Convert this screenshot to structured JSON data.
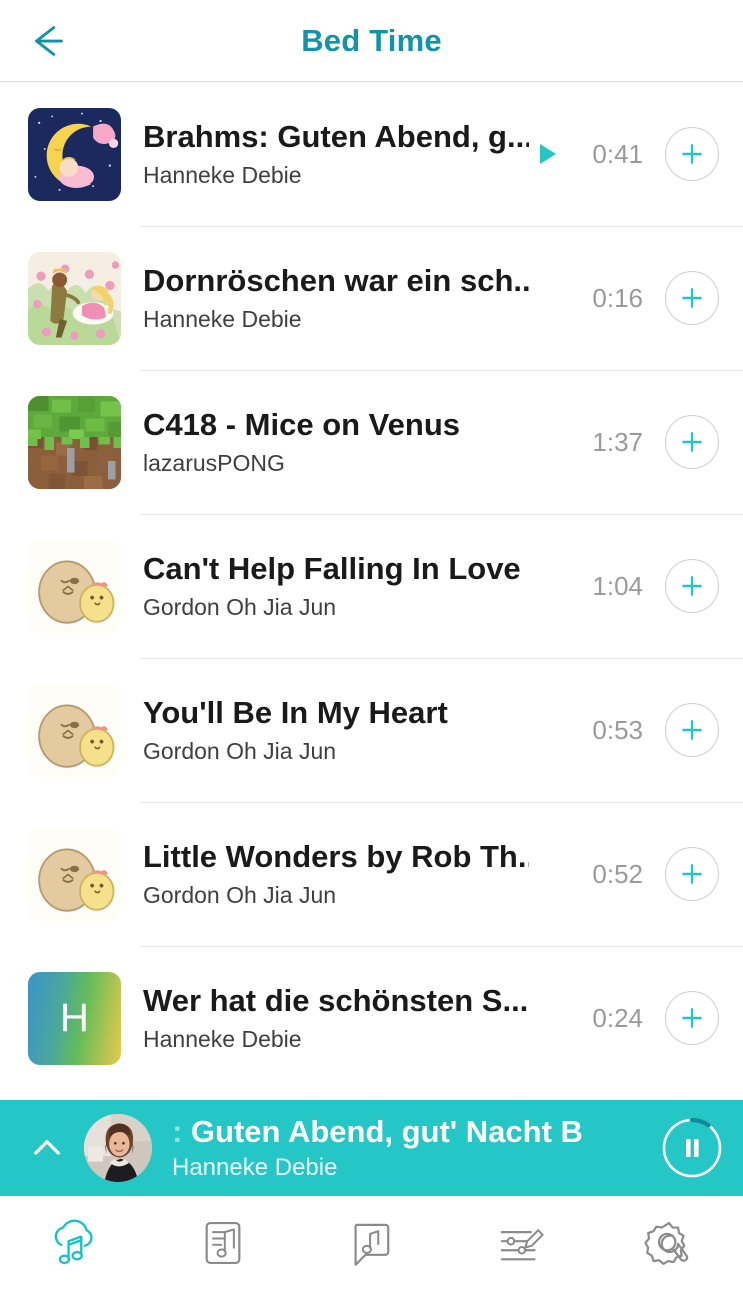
{
  "header": {
    "title": "Bed Time",
    "back_icon": "arrow-left-icon",
    "title_color": "#1193a8"
  },
  "theme": {
    "accent": "#25c6c6",
    "title_teal": "#1193a8",
    "duration_gray": "#9a9a9a",
    "divider": "#e6e6e6"
  },
  "tracks": [
    {
      "title": "Brahms: Guten Abend, g...",
      "artist": "Hanneke Debie",
      "duration": "0:41",
      "playing": true,
      "thumb": "moon-baby-artwork",
      "add_icon": "plus-icon"
    },
    {
      "title": "Dornröschen war ein sch...",
      "artist": "Hanneke Debie",
      "duration": "0:16",
      "playing": false,
      "thumb": "sleeping-beauty-artwork",
      "add_icon": "plus-icon"
    },
    {
      "title": "C418 - Mice on Venus",
      "artist": "lazarusPONG",
      "duration": "1:37",
      "playing": false,
      "thumb": "minecraft-grass-block-artwork",
      "add_icon": "plus-icon"
    },
    {
      "title": "Can't Help Falling In Love",
      "artist": "Gordon Oh Jia Jun",
      "duration": "1:04",
      "playing": false,
      "thumb": "bear-chick-artwork",
      "add_icon": "plus-icon"
    },
    {
      "title": "You'll Be In My Heart",
      "artist": "Gordon Oh Jia Jun",
      "duration": "0:53",
      "playing": false,
      "thumb": "bear-chick-artwork",
      "add_icon": "plus-icon"
    },
    {
      "title": "Little Wonders by Rob Th...",
      "artist": "Gordon Oh Jia Jun",
      "duration": "0:52",
      "playing": false,
      "thumb": "bear-chick-artwork",
      "add_icon": "plus-icon"
    },
    {
      "title": "Wer hat die schönsten S...",
      "artist": "Hanneke Debie",
      "duration": "0:24",
      "playing": false,
      "thumb": "letter-tile",
      "thumb_letter": "H",
      "add_icon": "plus-icon"
    }
  ],
  "mini_player": {
    "title": ": Guten Abend, gut' Nacht  B",
    "artist": "Hanneke Debie",
    "expand_icon": "chevron-up-icon",
    "toggle_icon": "pause-icon",
    "avatar": "artist-photo-avatar",
    "progress_percent": 10,
    "background": "#25c6c6"
  },
  "bottom_nav": [
    {
      "name": "nav-cloud-music",
      "icon": "cloud-music-icon",
      "active": true
    },
    {
      "name": "nav-playlists",
      "icon": "document-music-icon",
      "active": false
    },
    {
      "name": "nav-requests",
      "icon": "speech-bubble-music-icon",
      "active": false
    },
    {
      "name": "nav-mixer",
      "icon": "mixer-edit-icon",
      "active": false
    },
    {
      "name": "nav-settings",
      "icon": "gear-wrench-icon",
      "active": false
    }
  ]
}
